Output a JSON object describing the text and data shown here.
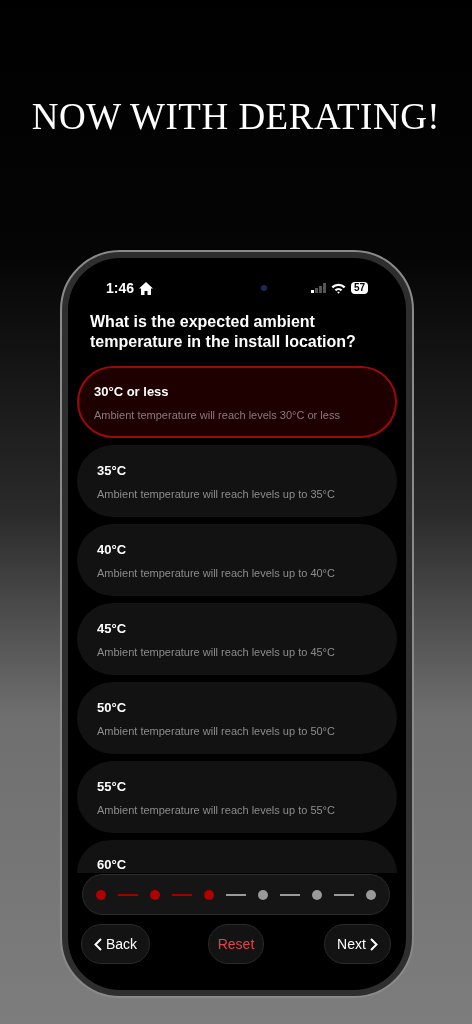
{
  "headline": "NOW WITH DERATING!",
  "status_bar": {
    "time": "1:46",
    "battery": "57"
  },
  "question": "What is the expected ambient temperature in the install location?",
  "options": [
    {
      "title": "30°C or less",
      "description": "Ambient temperature will reach levels 30°C or less",
      "selected": true
    },
    {
      "title": "35°C",
      "description": "Ambient temperature will reach levels up to 35°C",
      "selected": false
    },
    {
      "title": "40°C",
      "description": "Ambient temperature will reach levels up to 40°C",
      "selected": false
    },
    {
      "title": "45°C",
      "description": "Ambient temperature will reach levels up to 45°C",
      "selected": false
    },
    {
      "title": "50°C",
      "description": "Ambient temperature will reach levels up to 50°C",
      "selected": false
    },
    {
      "title": "55°C",
      "description": "Ambient temperature will reach levels up to 55°C",
      "selected": false
    },
    {
      "title": "60°C",
      "selected": false
    }
  ],
  "steps": [
    {
      "done": true
    },
    {
      "done": true
    },
    {
      "done": true
    },
    {
      "done": false
    },
    {
      "done": false
    },
    {
      "done": false
    }
  ],
  "buttons": {
    "back": "Back",
    "reset": "Reset",
    "next": "Next"
  }
}
